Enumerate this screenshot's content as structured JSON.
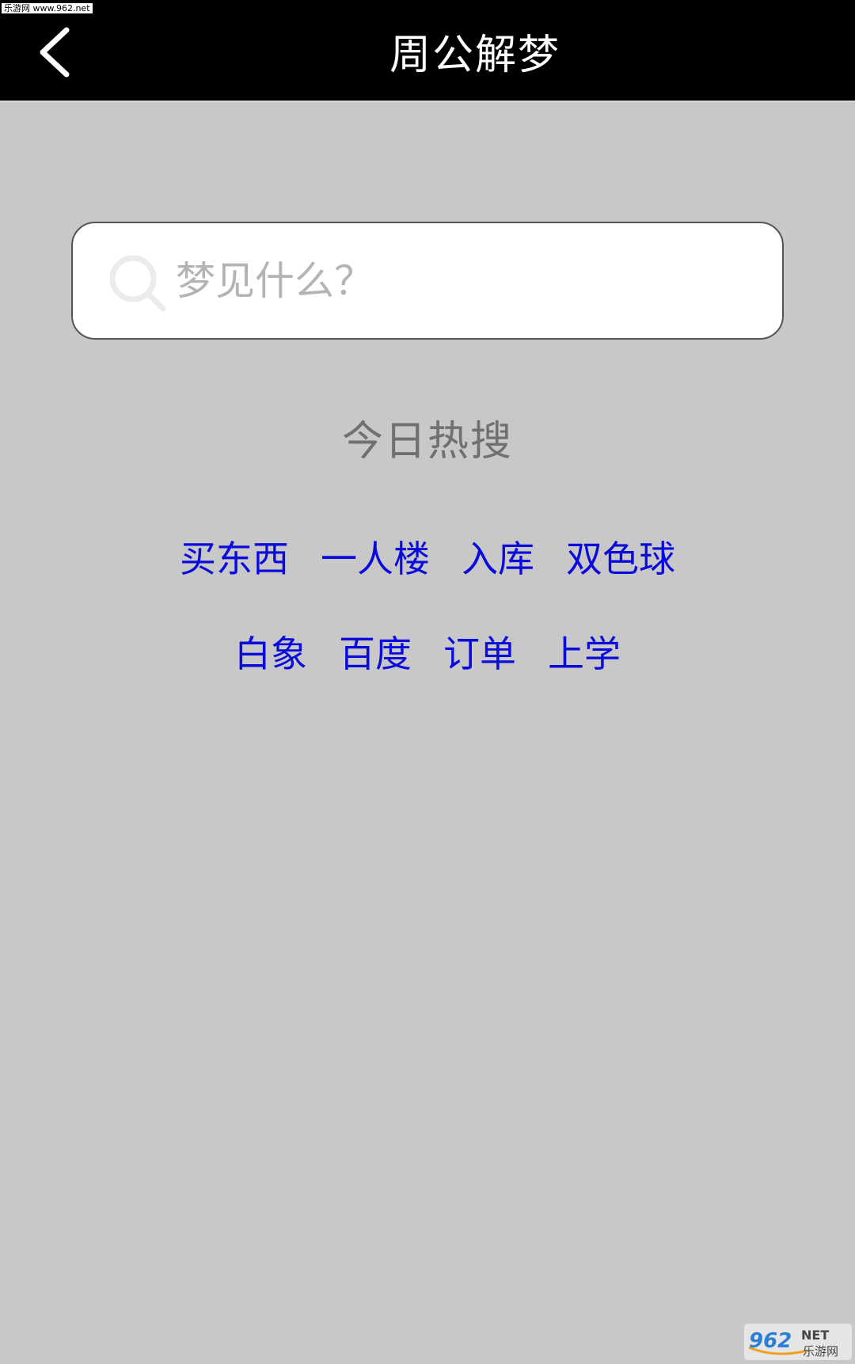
{
  "watermark_top": "乐游网 www.962.net",
  "header": {
    "title": "周公解梦"
  },
  "search": {
    "value": "",
    "placeholder": "梦见什么？"
  },
  "hot": {
    "title": "今日热搜",
    "row1": [
      "买东西",
      "一人楼",
      "入库",
      "双色球"
    ],
    "row2": [
      "白象",
      "百度",
      "订单",
      "上学"
    ]
  },
  "watermark_bottom": {
    "number": "962",
    "suffix": "NET",
    "name": "乐游网"
  },
  "colors": {
    "header_bg": "#000000",
    "page_bg": "#c8c8c8",
    "tag_text": "#0a0adc",
    "hot_title_text": "#707070"
  },
  "icons": {
    "back": "chevron-left-icon",
    "search": "search-icon"
  }
}
